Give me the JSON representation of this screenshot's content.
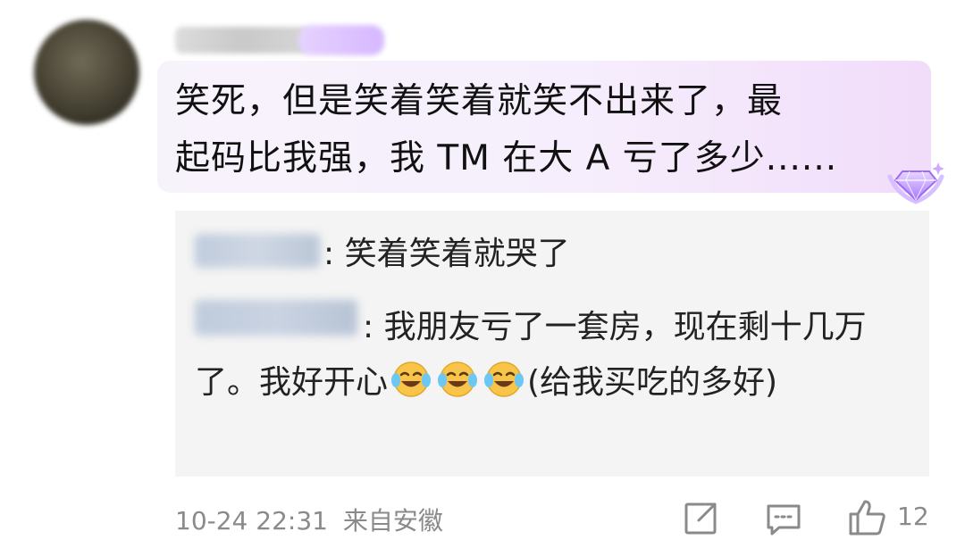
{
  "comment": {
    "text_line1": "笑死，但是笑着笑着就笑不出来了，最",
    "text_line2": "起码比我强，我 TM 在大 A 亏了多少......",
    "badge_icon": "diamond-gem-icon"
  },
  "replies": [
    {
      "text": ": 笑着笑着就哭了"
    },
    {
      "text_part1": ": 我朋友亏了一套房，现在剩十几万了。我好开心",
      "emoji": "laughing-tears-emoji",
      "text_part2": "(给我买吃的多好)"
    }
  ],
  "footer": {
    "date": "10-24 22:31",
    "location": "来自安徽",
    "like_count": "12",
    "share_icon": "share-icon",
    "comment_icon": "comment-icon",
    "like_icon": "thumbs-up-icon"
  },
  "colors": {
    "meta_gray": "#8a8a8a",
    "bubble_pink": "#f1dcfa",
    "gem_purple": "#b58cff"
  }
}
